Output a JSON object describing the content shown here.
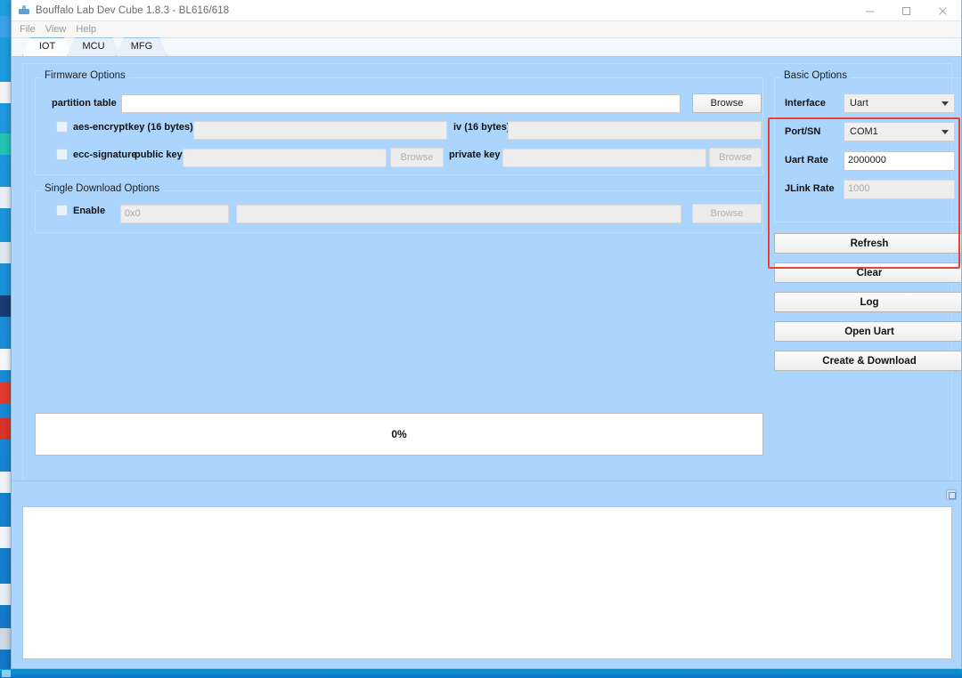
{
  "window": {
    "title": "Bouffalo Lab Dev Cube 1.8.3 - BL616/618",
    "app_icon": "chip-icon",
    "controls": {
      "minimize": "minimize-icon",
      "maximize": "maximize-icon",
      "close": "close-icon"
    }
  },
  "menubar": {
    "items": [
      {
        "label": "File"
      },
      {
        "label": "View"
      },
      {
        "label": "Help"
      }
    ]
  },
  "tabs": [
    {
      "label": "IOT",
      "active": true
    },
    {
      "label": "MCU",
      "active": false
    },
    {
      "label": "MFG",
      "active": false
    }
  ],
  "firmware_options": {
    "title": "Firmware Options",
    "partition_table": {
      "label": "partition table",
      "value": "",
      "placeholder": "",
      "browse_label": "Browse",
      "enabled": true
    },
    "aes_encrypt": {
      "checkbox_label": "aes-encrypt",
      "checked": false,
      "key_label": "key (16 bytes)",
      "key_value": "",
      "iv_label": "iv (16 bytes)",
      "iv_value": ""
    },
    "ecc_signature": {
      "checkbox_label": "ecc-signature",
      "checked": false,
      "public_key_label": "public key",
      "public_key_value": "",
      "public_key_browse": "Browse",
      "private_key_label": "private key",
      "private_key_value": "",
      "private_key_browse": "Browse"
    }
  },
  "single_download_options": {
    "title": "Single Download Options",
    "enable_label": "Enable",
    "enabled": false,
    "address_value": "",
    "address_placeholder": "0x0",
    "file_value": "",
    "browse_label": "Browse"
  },
  "basic_options": {
    "title": "Basic Options",
    "fields": [
      {
        "label": "Interface",
        "type": "combo",
        "value": "Uart",
        "enabled": true
      },
      {
        "label": "Port/SN",
        "type": "combo",
        "value": "COM1",
        "enabled": true
      },
      {
        "label": "Uart Rate",
        "type": "text",
        "value": "2000000",
        "enabled": true
      },
      {
        "label": "JLink Rate",
        "type": "text",
        "value": "1000",
        "enabled": false
      }
    ],
    "highlight_color": "#e8413c"
  },
  "action_buttons": [
    {
      "label": "Refresh"
    },
    {
      "label": "Clear"
    },
    {
      "label": "Log"
    },
    {
      "label": "Open Uart"
    },
    {
      "label": "Create & Download"
    }
  ],
  "progress": {
    "value_text": "0%",
    "percent": 0
  },
  "log_area": {
    "text": "",
    "grip_icon": "resize-grip-icon"
  },
  "colors": {
    "panel_background": "#abd5fd",
    "desktop": "#1a8fd6",
    "accent_red": "#e8413c"
  }
}
